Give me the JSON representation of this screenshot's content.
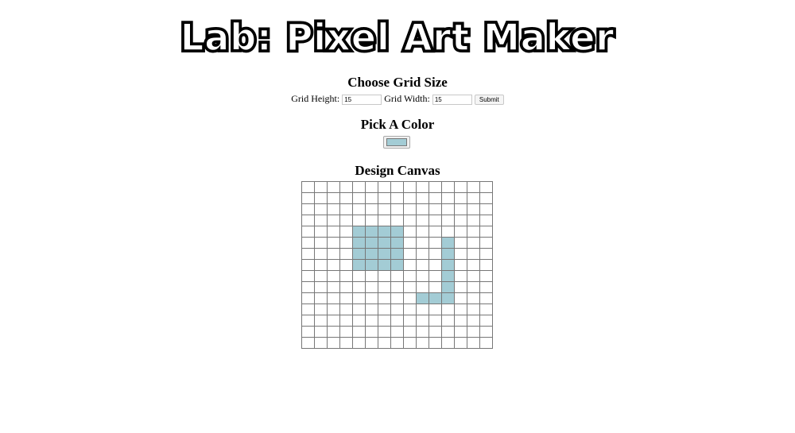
{
  "page": {
    "title": "Lab: Pixel Art Maker"
  },
  "grid_size": {
    "heading": "Choose Grid Size",
    "height_label": "Grid Height:",
    "height_value": "15",
    "width_label": "Grid Width:",
    "width_value": "15",
    "submit_label": "Submit"
  },
  "color_picker": {
    "heading": "Pick A Color",
    "selected_color": "#a3ccd5"
  },
  "canvas": {
    "heading": "Design Canvas",
    "rows": 15,
    "cols": 15,
    "cell_border_color": "#777777",
    "filled_color": "#a3ccd5",
    "filled_cells": [
      [
        4,
        4
      ],
      [
        4,
        5
      ],
      [
        4,
        6
      ],
      [
        4,
        7
      ],
      [
        5,
        4
      ],
      [
        5,
        5
      ],
      [
        5,
        6
      ],
      [
        5,
        7
      ],
      [
        5,
        11
      ],
      [
        6,
        4
      ],
      [
        6,
        5
      ],
      [
        6,
        6
      ],
      [
        6,
        7
      ],
      [
        6,
        11
      ],
      [
        7,
        4
      ],
      [
        7,
        5
      ],
      [
        7,
        6
      ],
      [
        7,
        7
      ],
      [
        7,
        11
      ],
      [
        8,
        11
      ],
      [
        9,
        11
      ],
      [
        10,
        9
      ],
      [
        10,
        10
      ],
      [
        10,
        11
      ]
    ]
  }
}
